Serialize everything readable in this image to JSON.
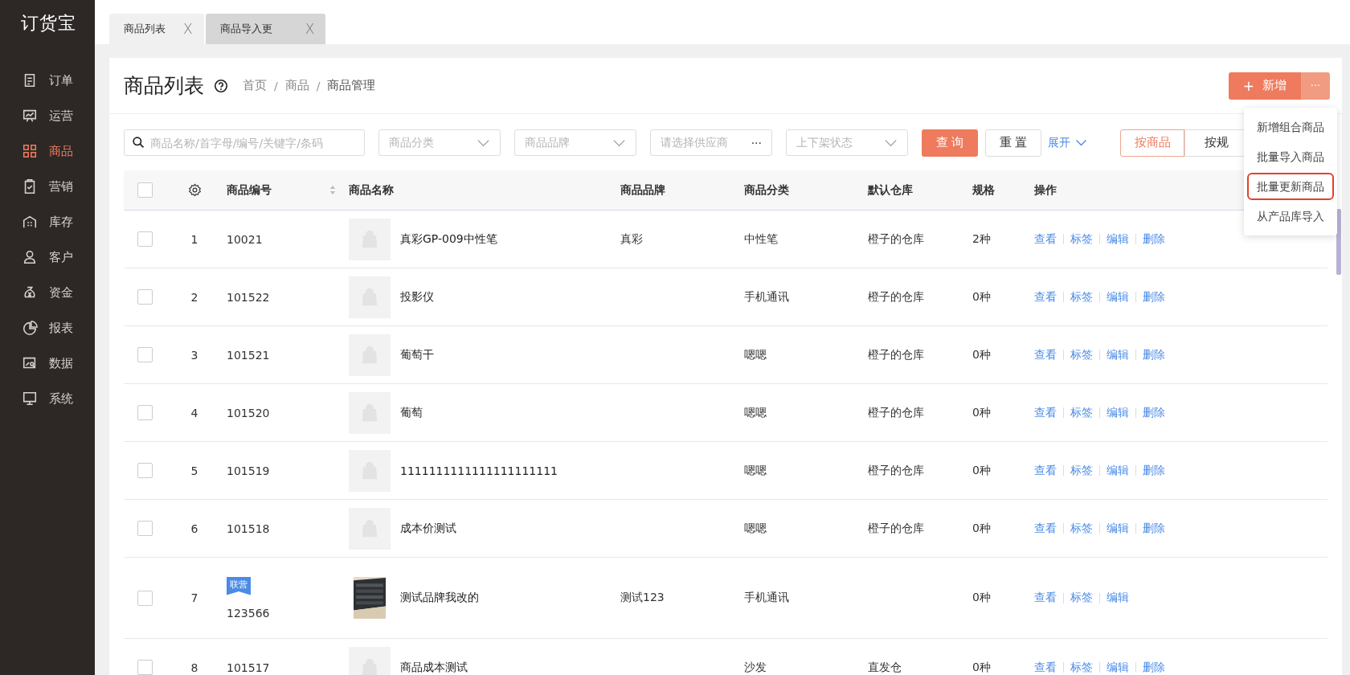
{
  "sidebar": {
    "logo": "订货宝",
    "items": [
      {
        "label": "订单",
        "selected": false
      },
      {
        "label": "运营",
        "selected": false
      },
      {
        "label": "商品",
        "selected": true
      },
      {
        "label": "营销",
        "selected": false
      },
      {
        "label": "库存",
        "selected": false
      },
      {
        "label": "客户",
        "selected": false
      },
      {
        "label": "资金",
        "selected": false
      },
      {
        "label": "报表",
        "selected": false
      },
      {
        "label": "数据",
        "selected": false
      },
      {
        "label": "系统",
        "selected": false
      }
    ]
  },
  "tabs": [
    {
      "label": "商品列表",
      "selected": true,
      "close": "X"
    },
    {
      "label": "商品导入更",
      "selected": false,
      "close": "X"
    }
  ],
  "page": {
    "title": "商品列表",
    "breadcrumb": [
      "首页",
      "商品",
      "商品管理"
    ],
    "breadcrumb_separator": "/",
    "new_button": "新增",
    "new_plus": "+",
    "more_button": "···"
  },
  "menu": [
    {
      "label": "新增组合商品",
      "highlighted": false
    },
    {
      "label": "批量导入商品",
      "highlighted": false
    },
    {
      "label": "批量更新商品",
      "highlighted": true
    },
    {
      "label": "从产品库导入",
      "highlighted": false
    }
  ],
  "filters": {
    "search": {
      "placeholder": "商品名称/首字母/编号/关键字/条码"
    },
    "selects": [
      {
        "placeholder": "商品分类",
        "kind": "dropdown"
      },
      {
        "placeholder": "商品品牌",
        "kind": "dropdown"
      },
      {
        "placeholder": "请选择供应商",
        "kind": "picker",
        "more": "···"
      },
      {
        "placeholder": "上下架状态",
        "kind": "dropdown"
      }
    ],
    "query": "查 询",
    "reset": "重 置",
    "expand": "展开",
    "view_toggle": [
      {
        "label": "按商品",
        "selected": true
      },
      {
        "label": "按规",
        "selected": false
      }
    ]
  },
  "table": {
    "header_checked": false,
    "columns": [
      "商品编号",
      "商品名称",
      "商品品牌",
      "商品分类",
      "默认仓库",
      "规格",
      "操作"
    ],
    "rows": [
      {
        "index": "1",
        "code": "10021",
        "kind": "placeholder",
        "name": "真彩GP-009中性笔",
        "brand": "真彩",
        "category": "中性笔",
        "warehouse": "橙子的仓库",
        "specs": "2种",
        "checked": false,
        "actions": [
          "查看",
          "标签",
          "编辑",
          "删除"
        ]
      },
      {
        "index": "2",
        "code": "101522",
        "kind": "placeholder",
        "name": "投影仪",
        "category": "手机通讯",
        "warehouse": "橙子的仓库",
        "specs": "0种",
        "checked": false,
        "actions": [
          "查看",
          "标签",
          "编辑",
          "删除"
        ]
      },
      {
        "index": "3",
        "code": "101521",
        "kind": "placeholder",
        "name": "葡萄干",
        "category": "嗯嗯",
        "warehouse": "橙子的仓库",
        "specs": "0种",
        "checked": false,
        "actions": [
          "查看",
          "标签",
          "编辑",
          "删除"
        ]
      },
      {
        "index": "4",
        "code": "101520",
        "kind": "placeholder",
        "name": "葡萄",
        "category": "嗯嗯",
        "warehouse": "橙子的仓库",
        "specs": "0种",
        "checked": false,
        "actions": [
          "查看",
          "标签",
          "编辑",
          "删除"
        ]
      },
      {
        "index": "5",
        "code": "101519",
        "kind": "placeholder",
        "name": "1111111111111111111111",
        "category": "嗯嗯",
        "warehouse": "橙子的仓库",
        "specs": "0种",
        "checked": false,
        "actions": [
          "查看",
          "标签",
          "编辑",
          "删除"
        ]
      },
      {
        "index": "6",
        "code": "101518",
        "kind": "placeholder",
        "name": "成本价测试",
        "category": "嗯嗯",
        "warehouse": "橙子的仓库",
        "specs": "0种",
        "checked": false,
        "actions": [
          "查看",
          "标签",
          "编辑",
          "删除"
        ]
      },
      {
        "index": "7",
        "tag": "联营",
        "code": "123566",
        "kind": "picture",
        "name": "测试品牌我改的",
        "brand": "测试123",
        "category": "手机通讯",
        "specs": "0种",
        "checked": false,
        "actions": [
          "查看",
          "标签",
          "编辑"
        ]
      },
      {
        "index": "8",
        "code": "101517",
        "kind": "placeholder",
        "name": "商品成本测试",
        "category": "沙发",
        "warehouse": "直发仓",
        "specs": "0种",
        "checked": false,
        "actions": [
          "查看",
          "标签",
          "编辑",
          "删除"
        ]
      }
    ]
  }
}
